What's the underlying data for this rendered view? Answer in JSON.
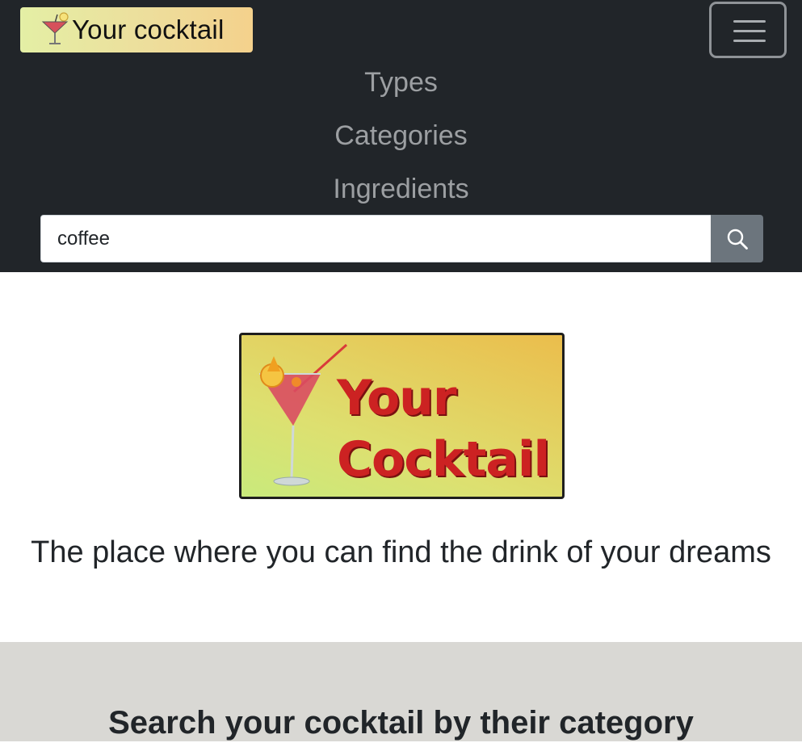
{
  "navbar": {
    "brand_label": "Your cocktail",
    "links": [
      "Types",
      "Categories",
      "Ingredients"
    ],
    "search": {
      "value": "coffee",
      "placeholder": ""
    }
  },
  "hero": {
    "logo_line1": "Your",
    "logo_line2": "Cocktail",
    "tagline": "The place where you can find the drink of your dreams"
  },
  "categories": {
    "title": "Search your cocktail by their category"
  },
  "icons": {
    "brand": "cocktail-glass-icon",
    "menu": "hamburger-menu-icon",
    "search": "magnifier-icon"
  },
  "colors": {
    "navbar_bg": "#212529",
    "nav_link": "#9c9fa2",
    "search_button": "#6c757d",
    "section_bg": "#d9d8d4",
    "logo_text": "#cc2222"
  }
}
